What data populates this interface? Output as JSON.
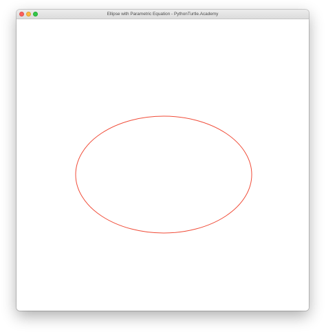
{
  "window": {
    "title": "Ellipse with Parametric Equation - PythonTurtle.Academy",
    "controls": [
      "close",
      "minimize",
      "zoom"
    ]
  },
  "drawing": {
    "shape": "ellipse",
    "stroke_color": "#f04a36",
    "background_color": "#ffffff"
  }
}
